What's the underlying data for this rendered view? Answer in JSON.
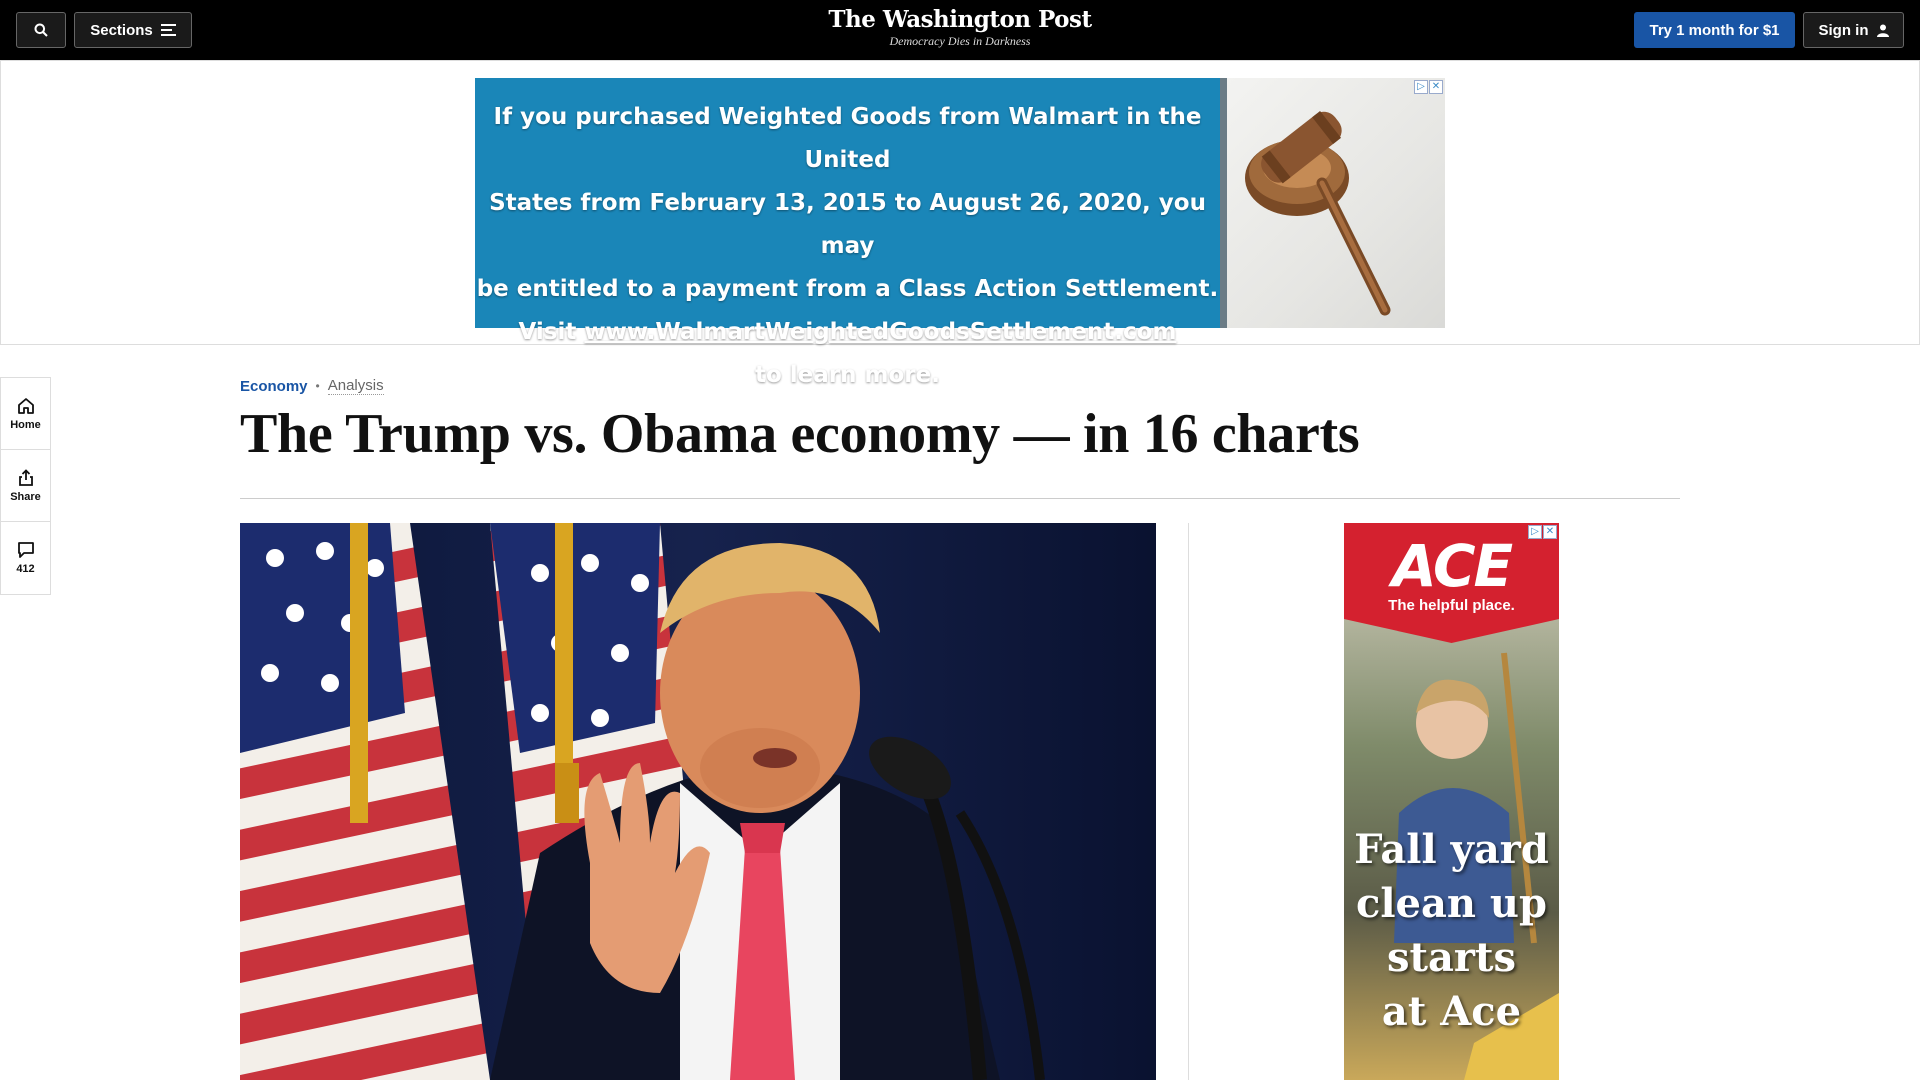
{
  "header": {
    "sections_label": "Sections",
    "logo": "The Washington Post",
    "tagline": "Democracy Dies in Darkness",
    "subscribe_label": "Try 1 month for $1",
    "signin_label": "Sign in"
  },
  "top_ad": {
    "line1": "If you purchased Weighted Goods from Walmart in the United",
    "line2": "States from February 13, 2015 to August 26, 2020, you may",
    "line3": "be entitled to a payment from a Class Action Settlement.",
    "line4_prefix": "Visit ",
    "line4_link": "www.WalmartWeightedGoodsSettlement.com",
    "line5": "to learn more."
  },
  "rail": {
    "home_label": "Home",
    "share_label": "Share",
    "comments_count": "412"
  },
  "article": {
    "section": "Economy",
    "label": "Analysis",
    "headline": "The Trump vs. Obama economy — in 16 charts"
  },
  "side_ad": {
    "brand": "ACE",
    "tagline": "The helpful place.",
    "copy_line1": "Fall yard",
    "copy_line2": "clean up",
    "copy_line3": "starts",
    "copy_line4": "at Ace"
  },
  "colors": {
    "accent": "#1955a5",
    "topbar": "#000000",
    "ad_blue": "#1a86b8",
    "ace_red": "#d4212f",
    "tie_pink": "#ff5a7a"
  }
}
